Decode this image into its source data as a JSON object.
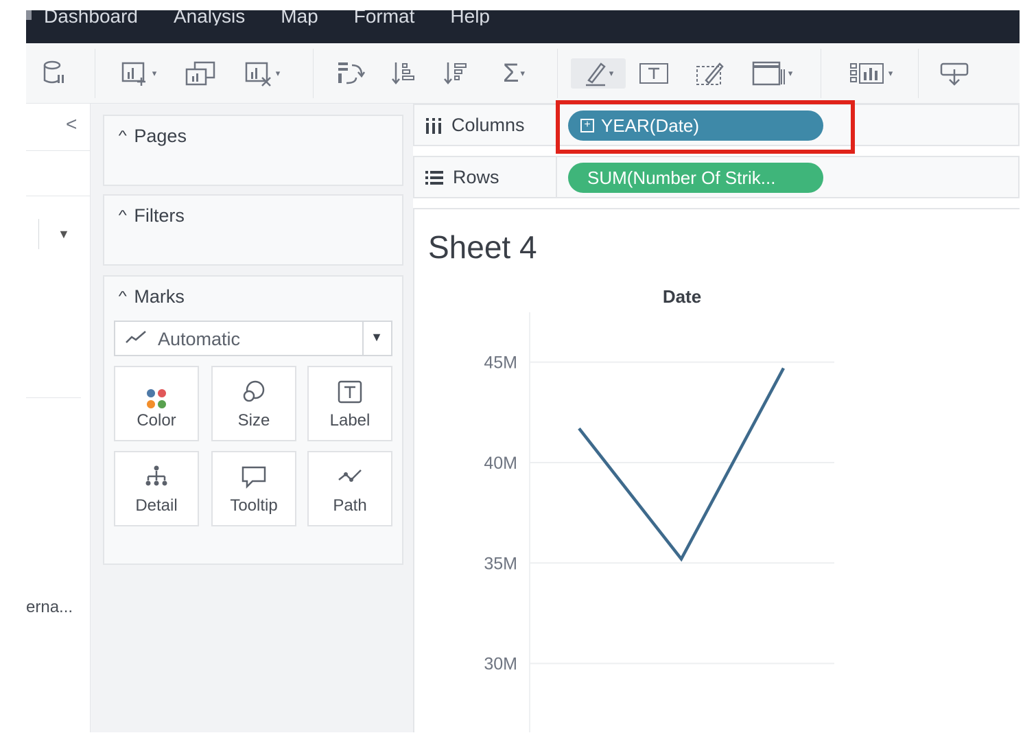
{
  "menu": {
    "items": [
      "Dashboard",
      "Analysis",
      "Map",
      "Format",
      "Help"
    ]
  },
  "toolbar": {
    "icons": [
      "datasource-pause-icon",
      "new-worksheet-icon",
      "duplicate-sheet-icon",
      "clear-sheet-icon",
      "swap-rows-columns-icon",
      "sort-ascending-icon",
      "sort-descending-icon",
      "totals-sigma-icon",
      "highlight-pen-icon",
      "label-t-icon",
      "annotate-icon",
      "fit-view-icon",
      "show-me-icon",
      "presentation-icon"
    ]
  },
  "datapane": {
    "truncated_text": "erna..."
  },
  "cards": {
    "pages_title": "Pages",
    "filters_title": "Filters",
    "marks_title": "Marks",
    "mark_type": "Automatic",
    "buttons": {
      "color": "Color",
      "size": "Size",
      "label": "Label",
      "detail": "Detail",
      "tooltip": "Tooltip",
      "path": "Path"
    }
  },
  "shelves": {
    "columns_label": "Columns",
    "columns_pill": "YEAR(Date)",
    "rows_label": "Rows",
    "rows_pill": "SUM(Number Of Strik..."
  },
  "colors": {
    "columns_pill": "#3e89a8",
    "rows_pill": "#3fb57a",
    "highlight": "#e0231a",
    "line": "#3e6a8c"
  },
  "sheet": {
    "title": "Sheet 4"
  },
  "chart_data": {
    "type": "line",
    "title": "",
    "column_header": "Date",
    "ylabel": "",
    "ylim_visible": [
      26.5,
      46.8
    ],
    "yticks": [
      45,
      40,
      35,
      30
    ],
    "ytick_labels": [
      "45M",
      "40M",
      "35M",
      "30M"
    ],
    "series": [
      {
        "values": [
          41.7,
          35.2,
          44.7
        ]
      }
    ],
    "grid": true
  }
}
